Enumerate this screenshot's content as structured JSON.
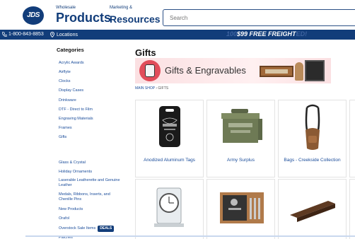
{
  "header": {
    "logo_text": "JDS",
    "brand_small_1": "Wholesale",
    "brand_big_1": "Products",
    "brand_small_2": "Marketing &",
    "brand_big_2": "Resources",
    "search_placeholder": "Search"
  },
  "topbar": {
    "phone": "1-800-843-8853",
    "locations": "Locations",
    "promo_prefix": "100",
    "promo_main": "$99 FREE FREIGHT",
    "promo_suffix": "ED!"
  },
  "sidebar": {
    "title": "Categories",
    "items": [
      "Acrylic Awards",
      "Airflyte",
      "Clocks",
      "Display Cases",
      "Drinkware",
      "DTF - Direct to Film",
      "Engraving Materials",
      "Frames",
      "Gifts",
      "Glass & Crystal",
      "Holiday Ornaments",
      "Laserable Leatherette and Genuine Leather",
      "Medals, Ribbons, Inserts, and Chenille Pins",
      "New Products",
      "Orafol",
      "Overstock Sale Items",
      "Patches"
    ],
    "deals_badge": "DEALS"
  },
  "main": {
    "title": "Gifts",
    "banner_text": "Gifts & Engravables",
    "breadcrumb_home": "MAIN SHOP",
    "breadcrumb_sep": "›",
    "breadcrumb_current": "GIFTS",
    "products": [
      {
        "label": "Anodized Aluminum Tags"
      },
      {
        "label": "Army Surplus"
      },
      {
        "label": "Bags - Creekside Collection"
      },
      {
        "label": ""
      },
      {
        "label": ""
      },
      {
        "label": ""
      }
    ]
  }
}
